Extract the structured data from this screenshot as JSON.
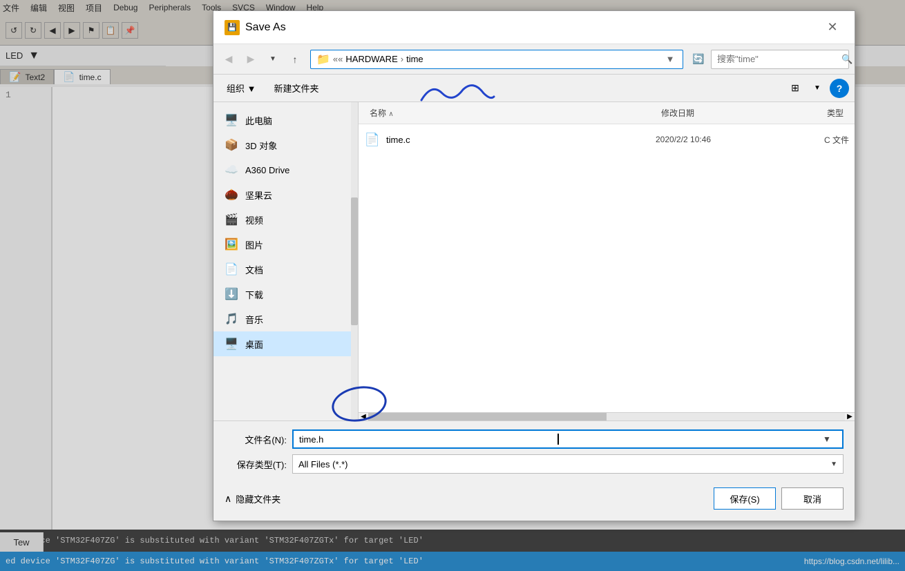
{
  "ide": {
    "menubar": [
      "文件",
      "编辑",
      "视图",
      "项目",
      "Debug",
      "Peripherals",
      "Tools",
      "SVCS",
      "Window",
      "Help"
    ],
    "led_label": "LED",
    "tabs": [
      {
        "label": "Text2",
        "active": false
      },
      {
        "label": "time.c",
        "active": true
      }
    ],
    "line_number": "1",
    "code_text": "",
    "tew_label": "Tew",
    "status_text": "ed device 'STM32F407ZG' is substituted with variant 'STM32F407ZGTx' for target 'LED'",
    "status_url": "https://blog.csdn.net/lilib..."
  },
  "dialog": {
    "title": "Save As",
    "title_icon": "💾",
    "close_btn": "✕",
    "navbar": {
      "back_disabled": true,
      "forward_disabled": true,
      "up_label": "↑",
      "path_parts": [
        "«« HARDWARE",
        "time"
      ],
      "search_placeholder": "搜索\"time\""
    },
    "toolbar2": {
      "organize_label": "组织 ▼",
      "new_folder_label": "新建文件夹",
      "view_icon": "⊞",
      "view_dropdown": "▼",
      "help_label": "?"
    },
    "columns": {
      "name": "名称",
      "sort_arrow": "∧",
      "date": "修改日期",
      "type": "类型"
    },
    "nav_items": [
      {
        "icon": "🖥️",
        "label": "此电脑"
      },
      {
        "icon": "📦",
        "label": "3D 对象"
      },
      {
        "icon": "☁️",
        "label": "A360 Drive"
      },
      {
        "icon": "🌰",
        "label": "坚果云"
      },
      {
        "icon": "🎬",
        "label": "视频"
      },
      {
        "icon": "🖼️",
        "label": "图片"
      },
      {
        "icon": "📄",
        "label": "文档"
      },
      {
        "icon": "⬇️",
        "label": "下载"
      },
      {
        "icon": "🎵",
        "label": "音乐"
      },
      {
        "icon": "🖥️",
        "label": "桌面"
      }
    ],
    "files": [
      {
        "icon": "📄",
        "name": "time.c",
        "date": "2020/2/2 10:46",
        "type": "C 文件"
      }
    ],
    "form": {
      "filename_label": "文件名(N):",
      "filename_value": "time.h",
      "filetype_label": "保存类型(T):",
      "filetype_value": "All Files (*.*)"
    },
    "actions": {
      "hide_folders_label": "∧  隐藏文件夹",
      "save_label": "保存(S)",
      "cancel_label": "取消"
    }
  }
}
